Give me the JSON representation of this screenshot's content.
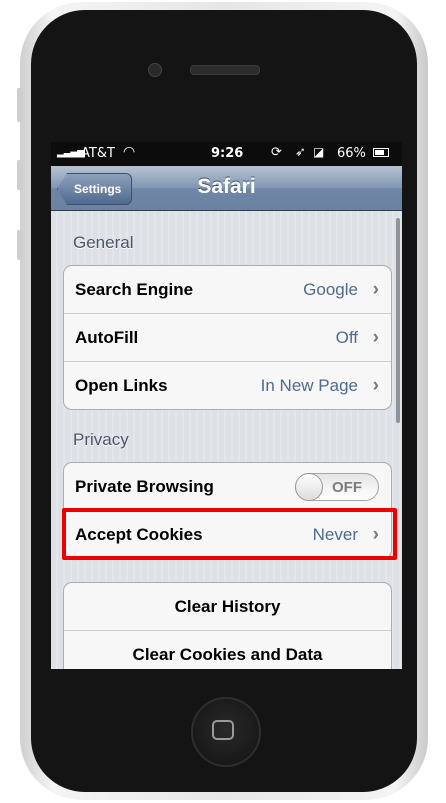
{
  "status_bar": {
    "carrier": "AT&T",
    "time": "9:26",
    "battery": "66%"
  },
  "nav": {
    "back_label": "Settings",
    "title": "Safari"
  },
  "general": {
    "header": "General",
    "rows": [
      {
        "label": "Search Engine",
        "value": "Google"
      },
      {
        "label": "AutoFill",
        "value": "Off"
      },
      {
        "label": "Open Links",
        "value": "In New Page"
      }
    ]
  },
  "privacy": {
    "header": "Privacy",
    "private_browsing": {
      "label": "Private Browsing",
      "toggle": "OFF"
    },
    "accept_cookies": {
      "label": "Accept Cookies",
      "value": "Never"
    }
  },
  "actions": {
    "clear_history": "Clear History",
    "clear_cookies": "Clear Cookies and Data"
  },
  "icons": {
    "chevron": "›"
  },
  "colors": {
    "highlight": "#ee0000",
    "value_text": "#4f6b8f",
    "navbar": "#6b82a3"
  }
}
